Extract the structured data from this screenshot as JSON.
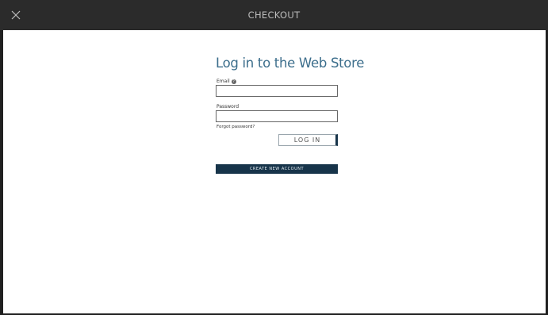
{
  "header": {
    "title": "CHECKOUT",
    "close_icon": "close-icon"
  },
  "login": {
    "title": "Log in to the Web Store",
    "email_label": "Email",
    "email_value": "",
    "help_icon": "help-icon",
    "password_label": "Password",
    "password_value": "",
    "forgot_label": "Forgot password?",
    "login_button": "LOG IN",
    "create_account_button": "CREATE NEW ACCOUNT"
  },
  "colors": {
    "topbar": "#2b2b2b",
    "title_blue": "#3c6e8c",
    "primary_dark": "#17344a"
  }
}
